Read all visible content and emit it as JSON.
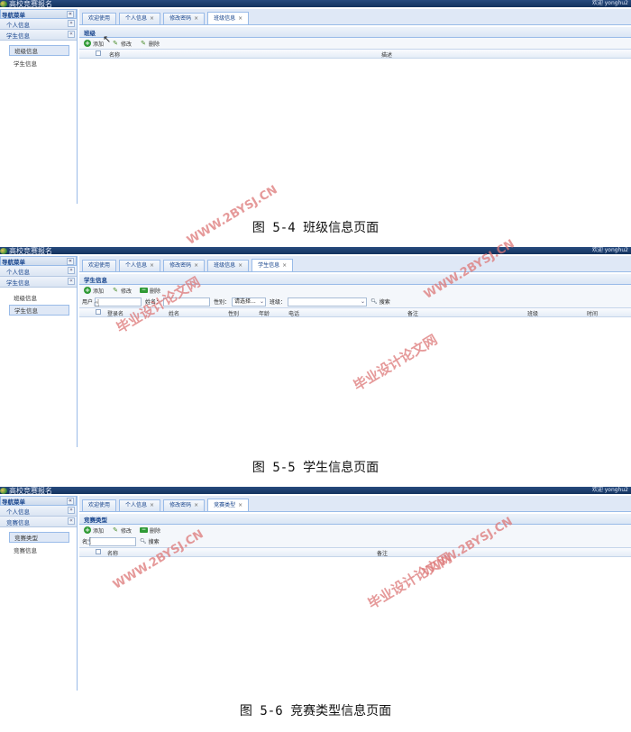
{
  "app_title": "高校竞赛报名",
  "welcome": "欢迎 yonghu2",
  "nav_title": "导航菜单",
  "screens": [
    {
      "groups": [
        "个人信息",
        "学生信息"
      ],
      "items": [
        "班级信息",
        "学生信息"
      ],
      "tabs": [
        "欢迎使用",
        "个人信息",
        "修改密码",
        "班级信息"
      ],
      "panel_title": "班级",
      "toolbar": [
        "添加",
        "修改",
        "删除"
      ],
      "columns": [
        "名称",
        "描述"
      ],
      "caption": "图 5-4 班级信息页面"
    },
    {
      "groups": [
        "个人信息",
        "学生信息"
      ],
      "items": [
        "班级信息",
        "学生信息"
      ],
      "tabs": [
        "欢迎使用",
        "个人信息",
        "修改密码",
        "班级信息",
        "学生信息"
      ],
      "panel_title": "学生信息",
      "toolbar": [
        "添加",
        "修改",
        "删除"
      ],
      "search": {
        "label1": "用户",
        "label2": "姓名：",
        "label3": "性别：",
        "select": "请选择...",
        "label4": "班级：",
        "button": "搜索"
      },
      "columns": [
        "登录名",
        "姓名",
        "性别",
        "年龄",
        "电话",
        "备注",
        "班级",
        "时间"
      ],
      "caption": "图 5-5 学生信息页面"
    },
    {
      "groups": [
        "个人信息",
        "竞赛信息"
      ],
      "items": [
        "竞赛类型",
        "竞赛信息"
      ],
      "tabs": [
        "欢迎使用",
        "个人信息",
        "修改密码",
        "竞赛类型"
      ],
      "panel_title": "竞赛类型",
      "toolbar": [
        "添加",
        "修改",
        "删除"
      ],
      "search": {
        "label1": "名",
        "button": "搜索"
      },
      "columns": [
        "名称",
        "备注"
      ],
      "caption": "图 5-6 竞赛类型信息页面"
    }
  ],
  "watermarks": {
    "site": "WWW.2BYSJ.CN",
    "text": "毕业设计论文网"
  },
  "icons": {
    "add": "plus-circle-icon",
    "edit": "pencil-icon",
    "del": "minus-icon",
    "search": "magnifier-icon",
    "collapse": "double-chevron-icon"
  }
}
